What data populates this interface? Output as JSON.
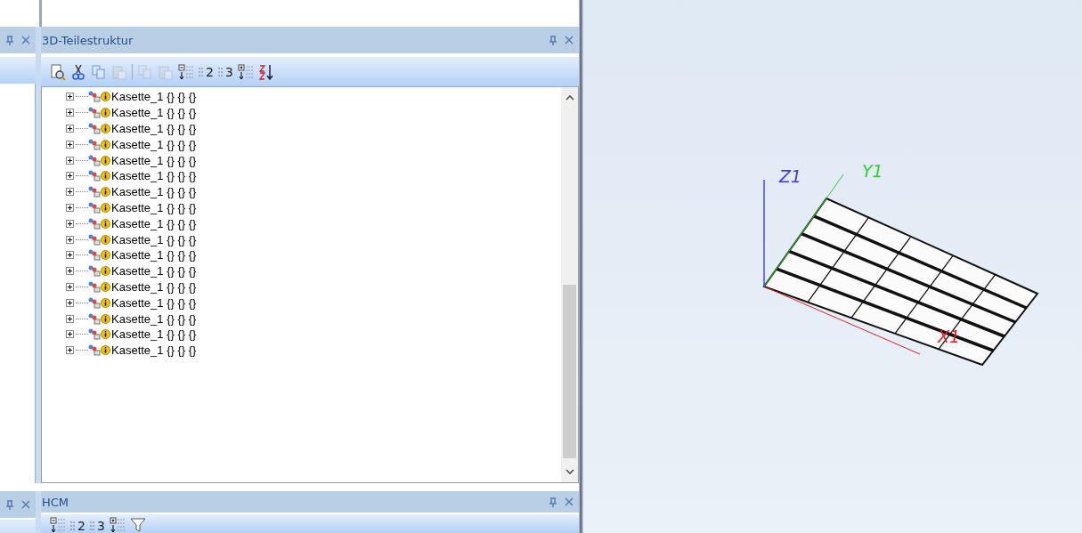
{
  "tree_panel": {
    "title": "3D-Teilestruktur",
    "toolbar": [
      {
        "kind": "preview",
        "disabled": false
      },
      {
        "kind": "cut",
        "disabled": false
      },
      {
        "kind": "copy",
        "disabled": false
      },
      {
        "kind": "paste",
        "disabled": true
      },
      {
        "kind": "separator"
      },
      {
        "kind": "copy-special",
        "disabled": true
      },
      {
        "kind": "paste-special",
        "disabled": true
      },
      {
        "kind": "collapse",
        "disabled": false
      },
      {
        "kind": "level",
        "label": "2",
        "disabled": false
      },
      {
        "kind": "level",
        "label": "3",
        "disabled": false
      },
      {
        "kind": "expand",
        "disabled": false
      },
      {
        "kind": "sort",
        "disabled": false
      }
    ],
    "rows": [
      {
        "label": "Kasette_1 {} {} {}",
        "expanded": false
      },
      {
        "label": "Kasette_1 {} {} {}",
        "expanded": false
      },
      {
        "label": "Kasette_1 {} {} {}",
        "expanded": false
      },
      {
        "label": "Kasette_1 {} {} {}",
        "expanded": false
      },
      {
        "label": "Kasette_1 {} {} {}",
        "expanded": false
      },
      {
        "label": "Kasette_1 {} {} {}",
        "expanded": false
      },
      {
        "label": "Kasette_1 {} {} {}",
        "expanded": false
      },
      {
        "label": "Kasette_1 {} {} {}",
        "expanded": false
      },
      {
        "label": "Kasette_1 {} {} {}",
        "expanded": false
      },
      {
        "label": "Kasette_1 {} {} {}",
        "expanded": false
      },
      {
        "label": "Kasette_1 {} {} {}",
        "expanded": false
      },
      {
        "label": "Kasette_1 {} {} {}",
        "expanded": false
      },
      {
        "label": "Kasette_1 {} {} {}",
        "expanded": false
      },
      {
        "label": "Kasette_1 {} {} {}",
        "expanded": false
      },
      {
        "label": "Kasette_1 {} {} {}",
        "expanded": false
      },
      {
        "label": "Kasette_1 {} {} {}",
        "expanded": false
      },
      {
        "label": "Kasette_1 {} {} {}",
        "expanded": false
      }
    ]
  },
  "hcm_panel": {
    "title": "HCM",
    "toolbar": [
      {
        "kind": "collapse",
        "disabled": false
      },
      {
        "kind": "level",
        "label": "2",
        "disabled": false
      },
      {
        "kind": "level",
        "label": "3",
        "disabled": false
      },
      {
        "kind": "expand",
        "disabled": false
      },
      {
        "kind": "filter",
        "disabled": false
      }
    ]
  },
  "viewport": {
    "axes": [
      {
        "kind": "z",
        "label": "Z1"
      },
      {
        "kind": "y",
        "label": "Y1"
      },
      {
        "kind": "x",
        "label": "X1"
      }
    ]
  }
}
